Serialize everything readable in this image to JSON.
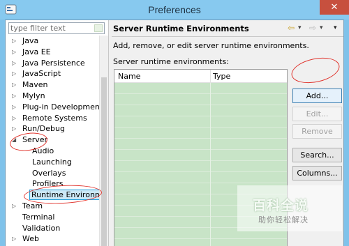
{
  "window": {
    "title": "Preferences",
    "close_glyph": "✕"
  },
  "left": {
    "filter_placeholder": "type filter text",
    "tree": [
      {
        "label": "Java",
        "arrow": "▷",
        "child": false,
        "selected": false
      },
      {
        "label": "Java EE",
        "arrow": "▷",
        "child": false,
        "selected": false
      },
      {
        "label": "Java Persistence",
        "arrow": "▷",
        "child": false,
        "selected": false
      },
      {
        "label": "JavaScript",
        "arrow": "▷",
        "child": false,
        "selected": false
      },
      {
        "label": "Maven",
        "arrow": "▷",
        "child": false,
        "selected": false
      },
      {
        "label": "Mylyn",
        "arrow": "▷",
        "child": false,
        "selected": false
      },
      {
        "label": "Plug-in Development",
        "arrow": "▷",
        "child": false,
        "selected": false
      },
      {
        "label": "Remote Systems",
        "arrow": "▷",
        "child": false,
        "selected": false
      },
      {
        "label": "Run/Debug",
        "arrow": "▷",
        "child": false,
        "selected": false
      },
      {
        "label": "Server",
        "arrow": "◢",
        "child": false,
        "selected": false
      },
      {
        "label": "Audio",
        "arrow": "",
        "child": true,
        "selected": false
      },
      {
        "label": "Launching",
        "arrow": "",
        "child": true,
        "selected": false
      },
      {
        "label": "Overlays",
        "arrow": "",
        "child": true,
        "selected": false
      },
      {
        "label": "Profilers",
        "arrow": "",
        "child": true,
        "selected": false
      },
      {
        "label": "Runtime Environm",
        "arrow": "",
        "child": true,
        "selected": true
      },
      {
        "label": "Team",
        "arrow": "▷",
        "child": false,
        "selected": false
      },
      {
        "label": "Terminal",
        "arrow": "",
        "child": false,
        "selected": false
      },
      {
        "label": "Validation",
        "arrow": "",
        "child": false,
        "selected": false
      },
      {
        "label": "Web",
        "arrow": "▷",
        "child": false,
        "selected": false
      }
    ]
  },
  "right": {
    "page_title": "Server Runtime Environments",
    "nav": {
      "back": "⇦",
      "back_menu": "▾",
      "forward": "⇨",
      "forward_menu": "▾",
      "view_menu": "▾"
    },
    "description": "Add, remove, or edit server runtime environments.",
    "list_label": "Server runtime environments:",
    "columns": {
      "name": "Name",
      "type": "Type"
    },
    "buttons": {
      "add": "Add...",
      "edit": "Edit...",
      "remove": "Remove",
      "search": "Search...",
      "columns": "Columns..."
    }
  },
  "watermark": {
    "title": "百科全说",
    "subtitle": "助你轻松解决"
  },
  "colors": {
    "annotation": "#e0332c",
    "selection": "#cbe8f6",
    "table_bg": "#c8e4c7"
  }
}
